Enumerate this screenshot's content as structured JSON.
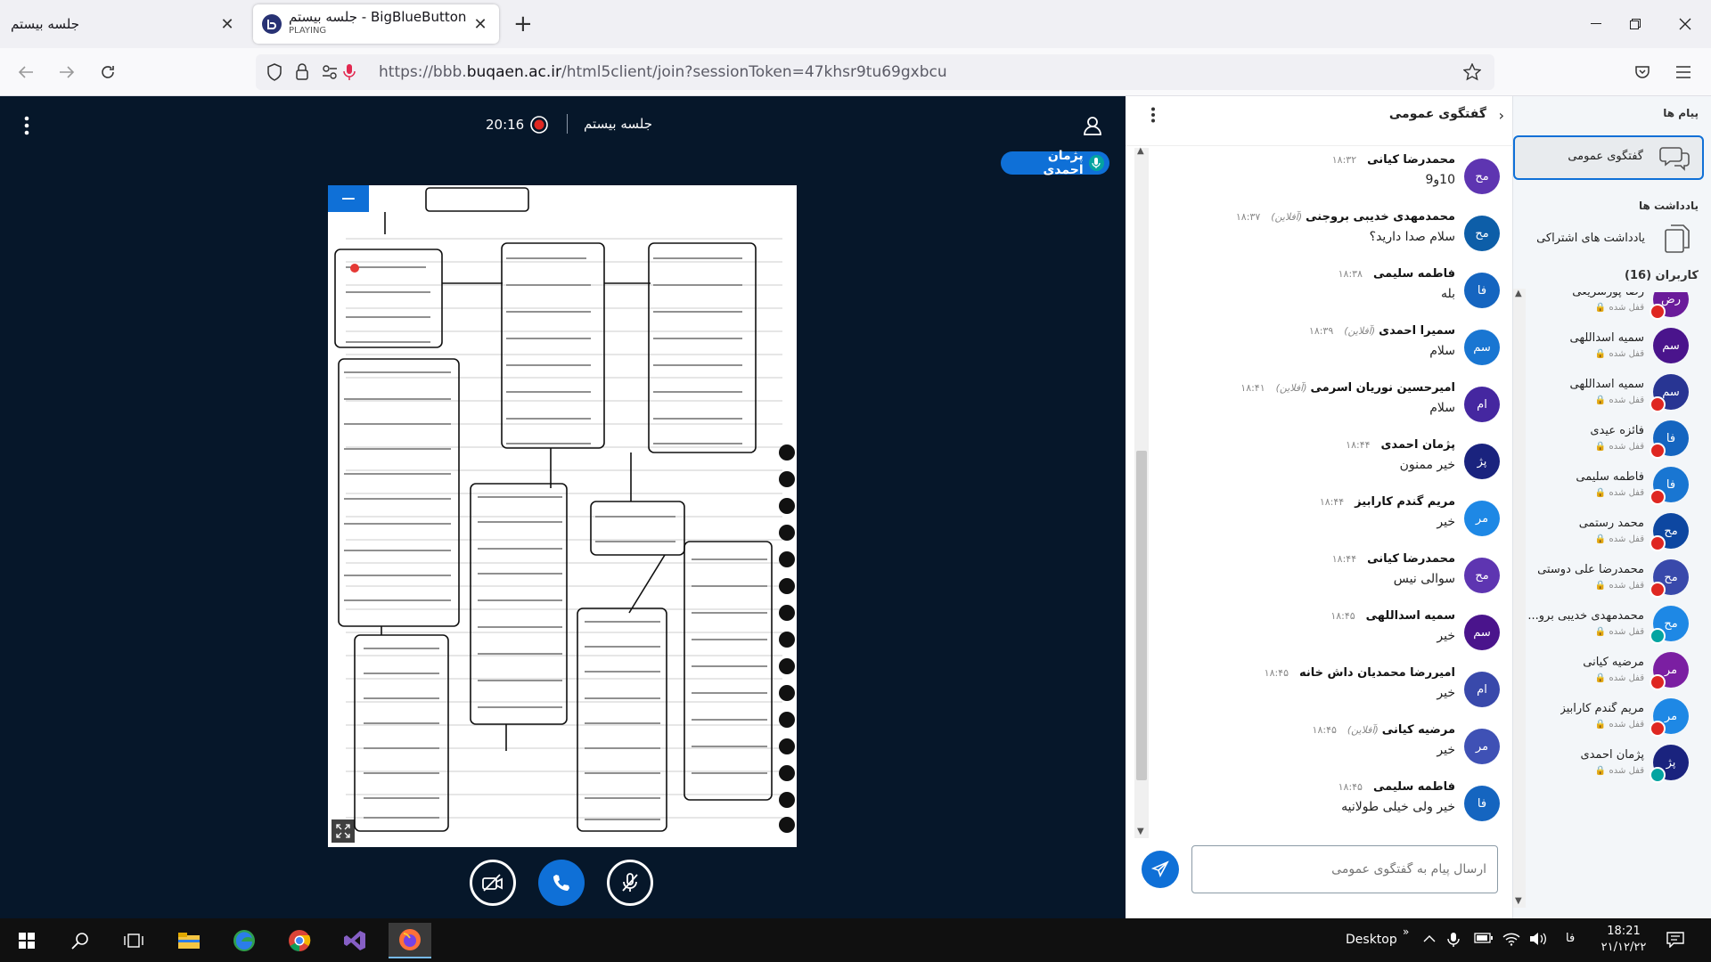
{
  "browser": {
    "tabs": [
      {
        "title": "جلسه بیستم",
        "active": false
      },
      {
        "title": "BigBlueButton - جلسه بیستم",
        "subtitle": "PLAYING",
        "active": true
      }
    ],
    "url_prefix": "https://bbb.",
    "url_domain": "buqaen.ac.ir",
    "url_rest": "/html5client/join?sessionToken=47khsr9tu69gxbcu"
  },
  "meeting": {
    "title": "جلسه بیستم",
    "recording_time": "20:16",
    "talker": "پژمان احمدی",
    "accent_color": "#0f70d7"
  },
  "chat": {
    "title": "گفتگوی عمومی",
    "input_placeholder": "ارسال پیام به گفتگوی عمومی",
    "offline_label": "(آفلاین)",
    "messages": [
      {
        "initials": "مح",
        "name": "محمدرضا کیانی",
        "offline": false,
        "time": "۱۸:۳۲",
        "text": "10و9",
        "color": "#5e35b1"
      },
      {
        "initials": "مح",
        "name": "محمدمهدی خدیبی بروجنی",
        "offline": true,
        "time": "۱۸:۳۷",
        "text": "سلام صدا دارید؟",
        "color": "#0d5ea8"
      },
      {
        "initials": "فا",
        "name": "فاطمه سلیمی",
        "offline": false,
        "time": "۱۸:۳۸",
        "text": "بله",
        "color": "#1565c0"
      },
      {
        "initials": "سم",
        "name": "سمیرا احمدی",
        "offline": true,
        "time": "۱۸:۳۹",
        "text": "سلام",
        "color": "#1976d2"
      },
      {
        "initials": "ام",
        "name": "امیرحسین نوریان اسرمی",
        "offline": true,
        "time": "۱۸:۴۱",
        "text": "سلام",
        "color": "#4527a0"
      },
      {
        "initials": "پژ",
        "name": "پژمان احمدی",
        "offline": false,
        "time": "۱۸:۴۴",
        "text": "خیر ممنون",
        "color": "#1a237e"
      },
      {
        "initials": "مر",
        "name": "مریم گندم کارابیز",
        "offline": false,
        "time": "۱۸:۴۴",
        "text": "خیر",
        "color": "#1e88e5"
      },
      {
        "initials": "مح",
        "name": "محمدرضا کیانی",
        "offline": false,
        "time": "۱۸:۴۴",
        "text": "سوالی نیس",
        "color": "#5e35b1"
      },
      {
        "initials": "سم",
        "name": "سمیه اسداللهی",
        "offline": false,
        "time": "۱۸:۴۵",
        "text": "خیر",
        "color": "#4a148c"
      },
      {
        "initials": "ام",
        "name": "امیررضا محمدیان داش خانه",
        "offline": false,
        "time": "۱۸:۴۵",
        "text": "خیر",
        "color": "#3949ab"
      },
      {
        "initials": "مر",
        "name": "مرضیه کیانی",
        "offline": true,
        "time": "۱۸:۴۵",
        "text": "خیر",
        "color": "#3f51b5"
      },
      {
        "initials": "فا",
        "name": "فاطمه سلیمی",
        "offline": false,
        "time": "۱۸:۴۵",
        "text": "خیر ولی خیلی طولانیه",
        "color": "#1565c0"
      }
    ]
  },
  "user_panel": {
    "messages_header": "پیام ها",
    "public_chat": "گفتگوی عمومی",
    "notes_header": "یادداشت ها",
    "shared_notes": "یادداشت های اشتراکی",
    "users_header": "کاربران (16)",
    "users": [
      {
        "initials": "رض",
        "name": "رضا پورسریعی",
        "status": "قفل شده",
        "color": "#6a1b9a",
        "mic": "off"
      },
      {
        "initials": "سم",
        "name": "سمیه اسداللهی",
        "status": "قفل شده",
        "color": "#4a148c",
        "mic": "none"
      },
      {
        "initials": "سم",
        "name": "سمیه اسداللهی",
        "status": "قفل شده",
        "color": "#283593",
        "mic": "off"
      },
      {
        "initials": "فا",
        "name": "فائزه عیدی",
        "status": "قفل شده",
        "color": "#1565c0",
        "mic": "off"
      },
      {
        "initials": "فا",
        "name": "فاطمه سلیمی",
        "status": "قفل شده",
        "color": "#1976d2",
        "mic": "off"
      },
      {
        "initials": "مح",
        "name": "محمد رستمی",
        "status": "قفل شده",
        "color": "#0d47a1",
        "mic": "off"
      },
      {
        "initials": "مح",
        "name": "محمدرضا علی دوستی",
        "status": "قفل شده",
        "color": "#3949ab",
        "mic": "off"
      },
      {
        "initials": "مح",
        "name": "محمدمهدی خدیبی برو...",
        "status": "قفل شده",
        "color": "#1e88e5",
        "mic": "on"
      },
      {
        "initials": "مر",
        "name": "مرضیه کیانی",
        "status": "قفل شده",
        "color": "#7b1fa2",
        "mic": "off"
      },
      {
        "initials": "مر",
        "name": "مریم گندم کارابیز",
        "status": "قفل شده",
        "color": "#1e88e5",
        "mic": "off"
      },
      {
        "initials": "پژ",
        "name": "پژمان احمدی",
        "status": "قفل شده",
        "color": "#1a237e",
        "mic": "on"
      }
    ]
  },
  "taskbar": {
    "desktop_label": "Desktop",
    "lang": "فا",
    "time": "18:21",
    "date": "۲۱/۱۲/۲۲"
  }
}
